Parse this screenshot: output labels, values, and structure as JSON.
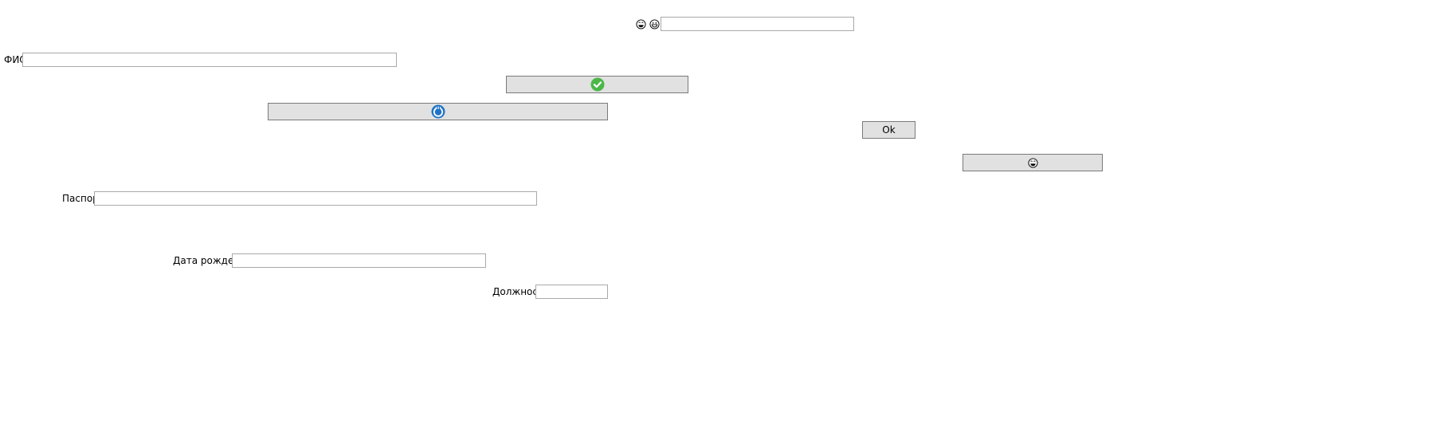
{
  "top_row": {
    "icons": [
      "laugh-face-icon",
      "grin-face-icon"
    ],
    "input_value": ""
  },
  "form": {
    "fio_label": "ФИО",
    "fio_value": "",
    "passport_label": "Паспорт",
    "passport_value": "",
    "birth_label": "Дата рождения",
    "birth_value": "",
    "position_label": "Должность",
    "position_value": ""
  },
  "buttons": {
    "check_icon": "check-circle-icon",
    "refresh_icon": "refresh-icon",
    "ok_label": "Ok",
    "emoji_icon": "laugh-face-icon"
  },
  "colors": {
    "button_bg": "#e1e1e1",
    "check_green": "#4cb748",
    "refresh_blue": "#1f73c7"
  }
}
